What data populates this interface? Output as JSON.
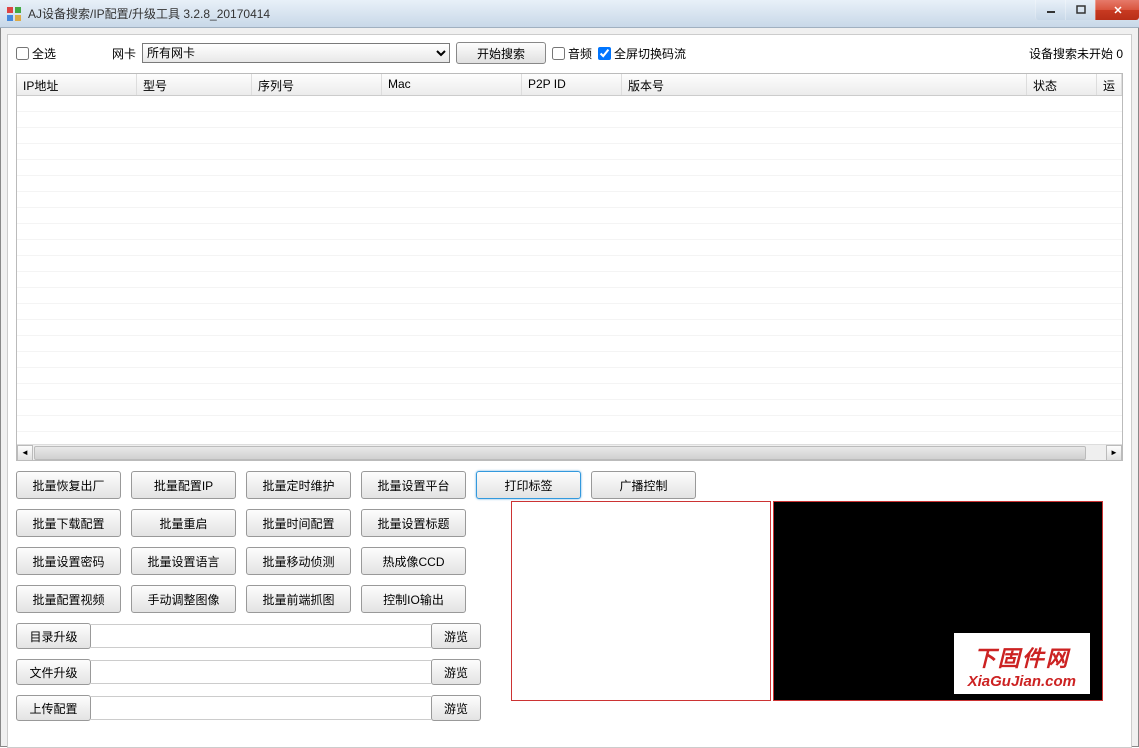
{
  "window": {
    "title": "AJ设备搜索/IP配置/升级工具 3.2.8_20170414"
  },
  "toolbar": {
    "select_all": "全选",
    "nic_label": "网卡",
    "nic_selected": "所有网卡",
    "start_search": "开始搜索",
    "audio": "音频",
    "fullscreen_switch": "全屏切换码流",
    "status": "设备搜索未开始 0"
  },
  "columns": {
    "ip": "IP地址",
    "model": "型号",
    "serial": "序列号",
    "mac": "Mac",
    "p2p": "P2P ID",
    "version": "版本号",
    "state": "状态",
    "run": "运"
  },
  "buttons": {
    "row1": {
      "b1": "批量恢复出厂",
      "b2": "批量配置IP",
      "b3": "批量定时维护",
      "b4": "批量设置平台",
      "b5": "打印标签",
      "b6": "广播控制"
    },
    "row2": {
      "b1": "批量下载配置",
      "b2": "批量重启",
      "b3": "批量时间配置",
      "b4": "批量设置标题"
    },
    "row3": {
      "b1": "批量设置密码",
      "b2": "批量设置语言",
      "b3": "批量移动侦测",
      "b4": "热成像CCD"
    },
    "row4": {
      "b1": "批量配置视频",
      "b2": "手动调整图像",
      "b3": "批量前端抓图",
      "b4": "控制IO输出"
    }
  },
  "file_rows": {
    "r1": {
      "label": "目录升级",
      "browse": "游览"
    },
    "r2": {
      "label": "文件升级",
      "browse": "游览"
    },
    "r3": {
      "label": "上传配置",
      "browse": "游览"
    }
  },
  "watermark": {
    "cn": "下固件网",
    "en": "XiaGuJian.com"
  }
}
